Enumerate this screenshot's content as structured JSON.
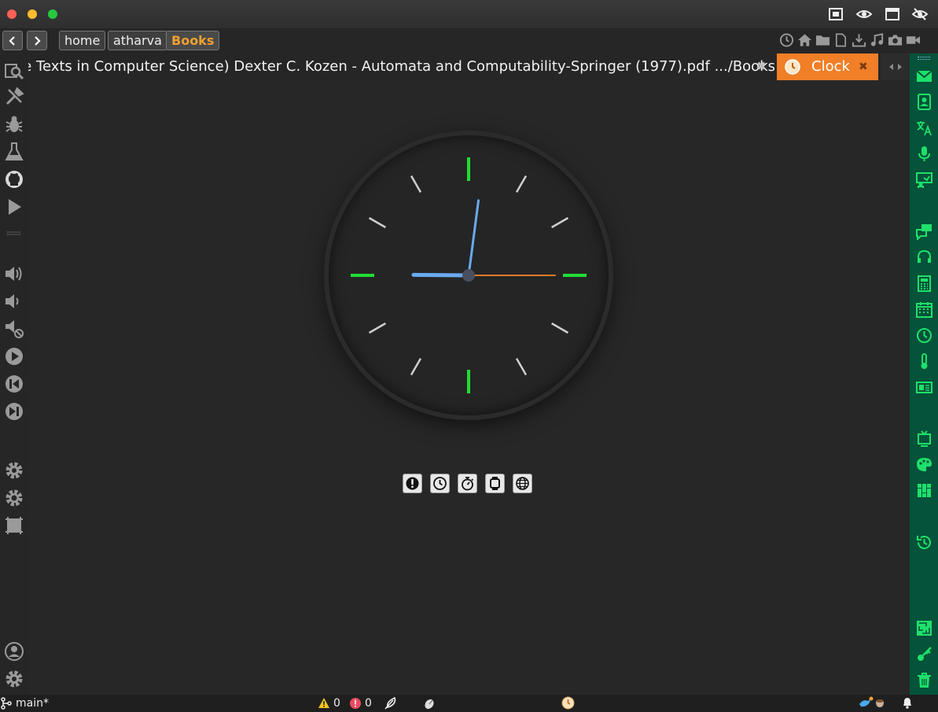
{
  "window": {
    "title_icons": [
      "fullscreen-icon",
      "eye-icon",
      "window-icon",
      "eye-off-icon"
    ]
  },
  "nav": {
    "back_label": "<",
    "forward_label": ">",
    "breadcrumbs": [
      "home",
      "atharva",
      "Books"
    ],
    "quick_icons": [
      "history-icon",
      "home-icon",
      "folder-icon",
      "file-icon",
      "download-icon",
      "music-icon",
      "camera-icon",
      "video-icon"
    ]
  },
  "tabs": {
    "file_tab": "(Graduate Texts in Computer Science) Dexter C. Kozen - Automata and Computability-Springer (1977).pdf .../Books",
    "close_glyph": "✖",
    "active_tab": "Clock"
  },
  "left_sidebar": {
    "icons": [
      "search-files-icon",
      "tools-icon",
      "bug-icon",
      "flask-icon",
      "github-icon",
      "play-icon",
      "grip-icon",
      "volume-up-icon",
      "volume-down-icon",
      "mute-icon",
      "play-circle-icon",
      "prev-circle-icon",
      "next-circle-icon",
      "settings-icon",
      "settings-alt-icon",
      "region-icon",
      "user-icon",
      "gear-icon"
    ]
  },
  "right_sidebar": {
    "icons": [
      "mail-icon",
      "contacts-icon",
      "translate-icon",
      "mic-icon",
      "presentation-icon",
      "chat-icon",
      "headset-icon",
      "calculator-icon",
      "calendar-icon",
      "clock-icon",
      "thermometer-icon",
      "news-icon",
      "tv-icon",
      "palette-icon",
      "apps-icon",
      "history-icon",
      "maze-icon",
      "key-icon",
      "trash-icon"
    ]
  },
  "clock": {
    "hour_value": 9,
    "minute_value": 1,
    "second_value": 15,
    "colors": {
      "hour_hand": "#6aaaf0",
      "minute_hand": "#6aaaf0",
      "second_hand": "#e07a2a",
      "major_tick": "#22dd33",
      "minor_tick": "#cfcfcf",
      "hub": "#4a4f60"
    }
  },
  "clock_modes": [
    "alarm-icon",
    "clock-icon",
    "timer-icon",
    "watch-icon",
    "world-clock-icon"
  ],
  "status": {
    "branch": "main*",
    "warnings": "0",
    "errors": "0",
    "accent": "#f07f28",
    "sidebar_color": "#04533a"
  }
}
